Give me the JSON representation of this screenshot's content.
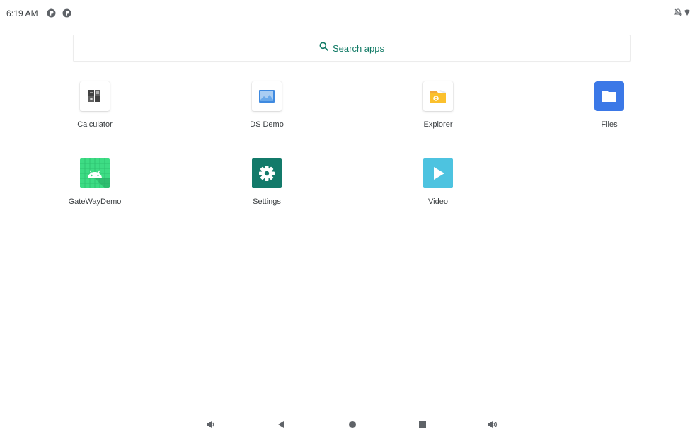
{
  "status_bar": {
    "time": "6:19 AM",
    "notification_icons": [
      "circle-p-icon",
      "circle-p-icon"
    ],
    "system_icons": [
      "bell-off-icon",
      "wifi-icon"
    ]
  },
  "search": {
    "label": "Search apps",
    "accent_color": "#117a65"
  },
  "apps": [
    {
      "label": "Calculator",
      "icon": "calculator-icon"
    },
    {
      "label": "DS Demo",
      "icon": "image-icon"
    },
    {
      "label": "Explorer",
      "icon": "folder-gear-icon"
    },
    {
      "label": "Files",
      "icon": "folder-icon"
    },
    {
      "label": "GateWayDemo",
      "icon": "android-icon"
    },
    {
      "label": "Settings",
      "icon": "gear-icon"
    },
    {
      "label": "Video",
      "icon": "play-icon"
    }
  ],
  "nav_bar": {
    "buttons": [
      "volume-down-icon",
      "back-icon",
      "home-icon",
      "recents-icon",
      "volume-up-icon"
    ]
  }
}
